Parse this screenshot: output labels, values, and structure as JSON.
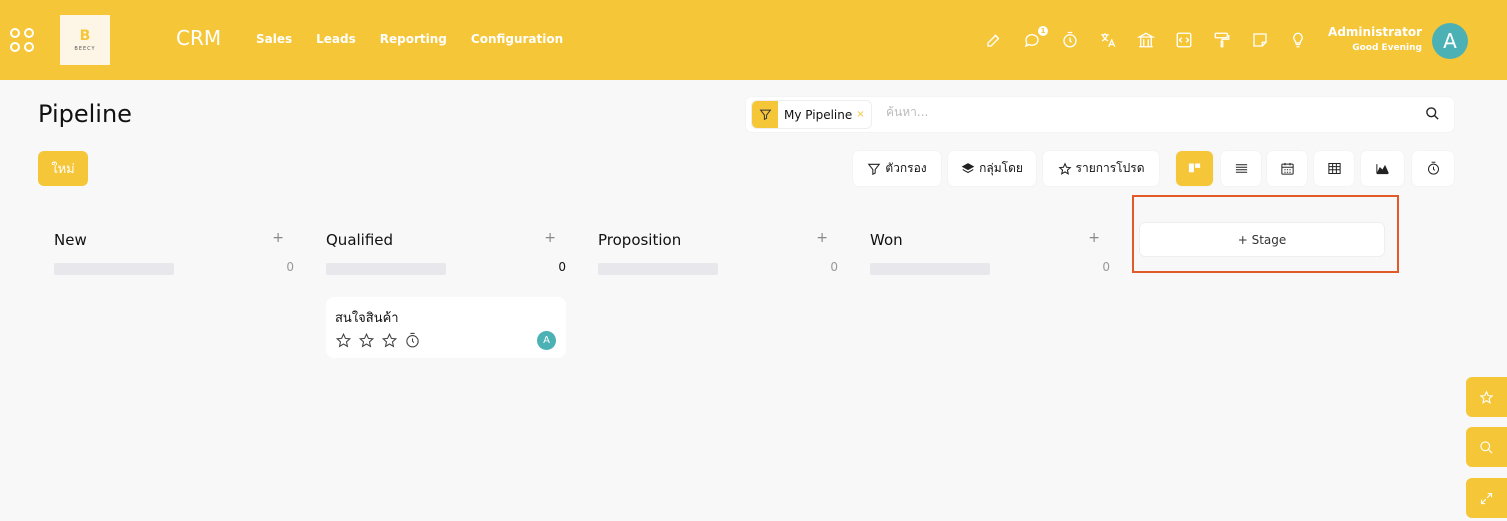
{
  "topbar": {
    "app_title": "CRM",
    "logo": {
      "letter": "B",
      "text": "BEECY"
    },
    "menu": [
      "Sales",
      "Leads",
      "Reporting",
      "Configuration"
    ],
    "message_badge": "1",
    "user": {
      "name": "Administrator",
      "greeting": "Good Evening",
      "avatar_letter": "A"
    },
    "icons": [
      "edit-icon",
      "chat-icon",
      "timer-icon",
      "translate-icon",
      "bank-icon",
      "code-icon",
      "paint-roller-icon",
      "note-icon",
      "lightbulb-icon"
    ]
  },
  "control": {
    "title": "Pipeline",
    "facet_label": "My Pipeline",
    "facet_close": "×",
    "search_placeholder": "ค้นหา...",
    "new_button": "ใหม่",
    "filter_label": "ตัวกรอง",
    "group_label": "กลุ่มโดย",
    "favorites_label": "รายการโปรด",
    "active_view": "kanban"
  },
  "kanban": {
    "columns": [
      {
        "title": "New",
        "add": "+",
        "count": "0"
      },
      {
        "title": "Qualified",
        "add": "+",
        "count": "0"
      },
      {
        "title": "Proposition",
        "add": "+",
        "count": "0"
      },
      {
        "title": "Won",
        "add": "+",
        "count": "0"
      }
    ],
    "card": {
      "title": "สนใจสินค้า",
      "avatar_letter": "A"
    },
    "add_stage_label": "+ Stage"
  },
  "colors": {
    "accent": "#f5c638",
    "avatar": "#4cb1b5",
    "highlight": "#e25a2a"
  }
}
